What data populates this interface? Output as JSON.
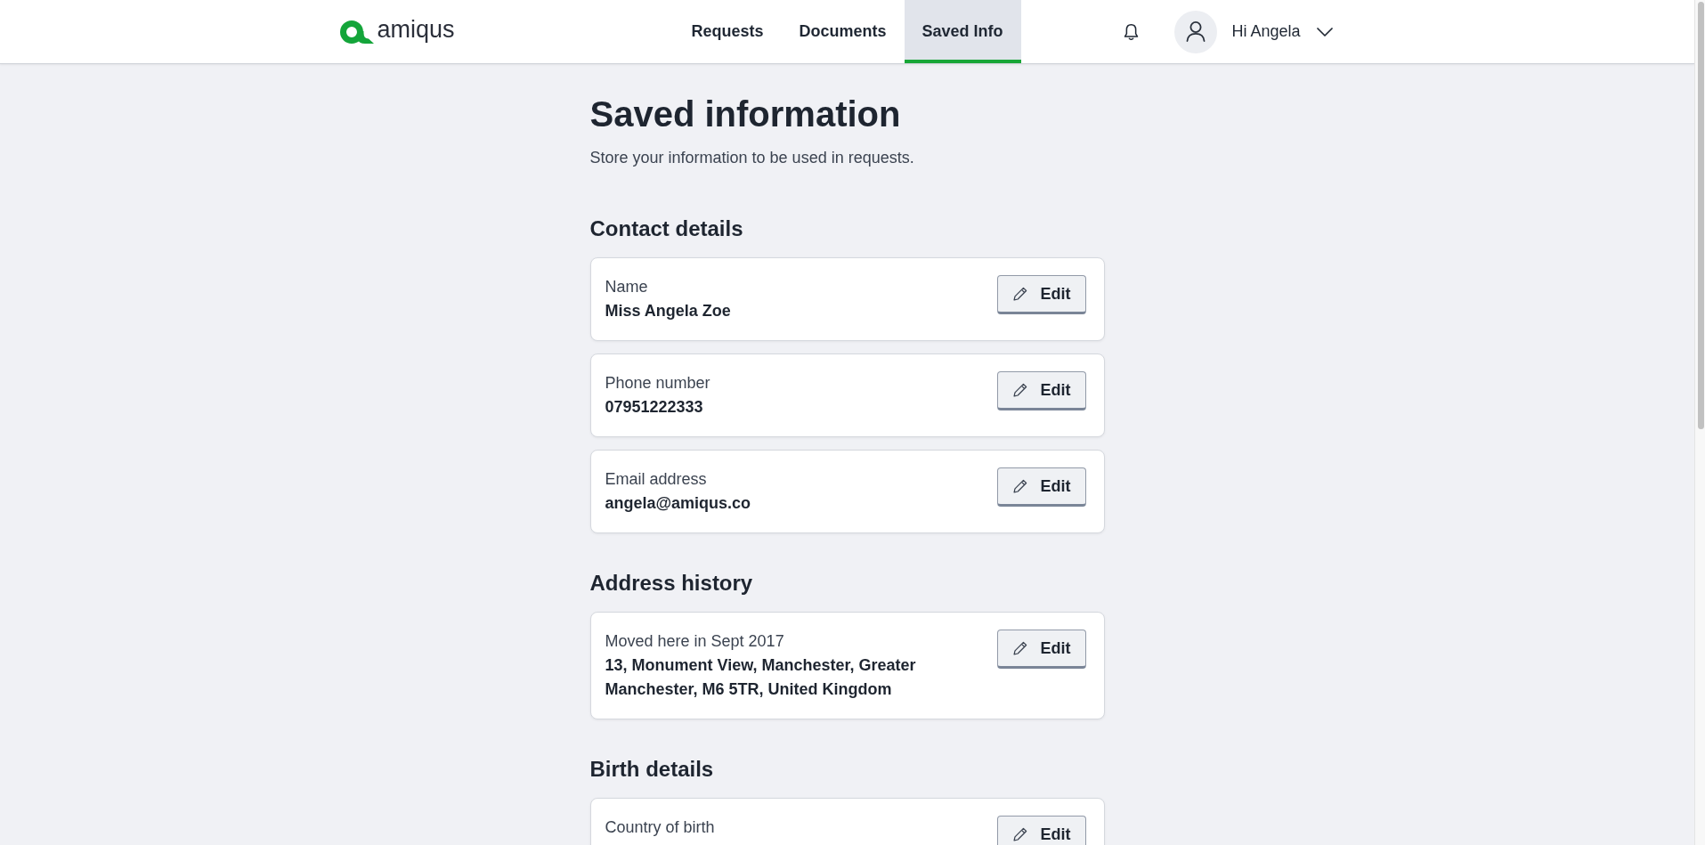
{
  "header": {
    "logo_text": "amiqus",
    "nav": [
      {
        "label": "Requests",
        "selected": false
      },
      {
        "label": "Documents",
        "selected": false
      },
      {
        "label": "Saved Info",
        "selected": true
      }
    ],
    "user": {
      "greeting": "Hi Angela"
    }
  },
  "page": {
    "title": "Saved information",
    "subtitle": "Store your information to be used in requests."
  },
  "sections": [
    {
      "heading": "Contact details",
      "items": [
        {
          "label": "Name",
          "value": "Miss Angela Zoe",
          "button": "Edit"
        },
        {
          "label": "Phone number",
          "value": "07951222333",
          "button": "Edit"
        },
        {
          "label": "Email address",
          "value": "angela@amiqus.co",
          "button": "Edit"
        }
      ]
    },
    {
      "heading": "Address history",
      "items": [
        {
          "label": "Moved here in Sept 2017",
          "value": "13, Monument View, Manchester, Greater Manchester, M6 5TR, United Kingdom",
          "button": "Edit"
        }
      ]
    },
    {
      "heading": "Birth details",
      "items": [
        {
          "label": "Country of birth",
          "button": "Edit"
        }
      ]
    }
  ]
}
